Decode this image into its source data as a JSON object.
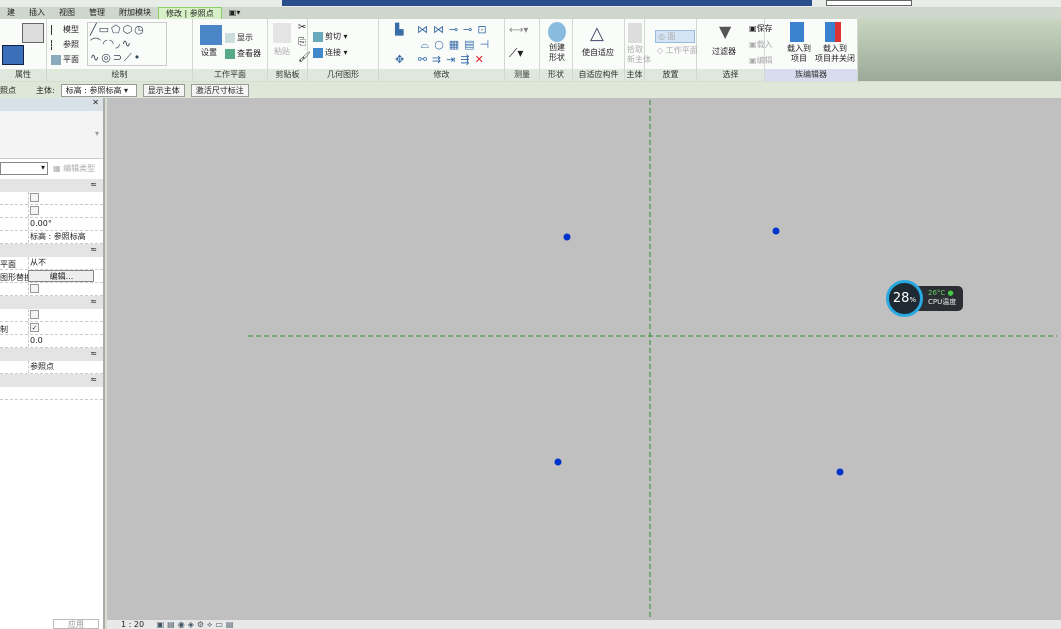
{
  "tabs": [
    "建",
    "插入",
    "视图",
    "管理",
    "附加模块",
    "修改 | 参照点",
    "▣▾"
  ],
  "active_tab": "修改 | 参照点",
  "ribbon": {
    "groups": [
      "属性",
      "绘制",
      "工作平面",
      "剪贴板",
      "几何图形",
      "修改",
      "测量",
      "形状",
      "自适应构件",
      "主体",
      "放置",
      "选择",
      "族编辑器"
    ],
    "draw": {
      "model": "模型",
      "ref": "参照",
      "plane": "平面"
    },
    "workplane": {
      "set": "设置",
      "show": "显示",
      "viewer": "查看器"
    },
    "clipboard": {
      "paste": "粘贴"
    },
    "geometry": {
      "cut": "剪切",
      "join": "连接"
    },
    "shape": {
      "create": "创建\n形状"
    },
    "adaptive": {
      "make": "使自适应"
    },
    "host": {
      "pick": "拾取\n新主体"
    },
    "place": {
      "face": "面",
      "workplane": "工作平面"
    },
    "select": {
      "filter": "过滤器",
      "save": "保存",
      "load": "载入",
      "edit": "编辑"
    },
    "family": {
      "load_project": "载入到\n项目",
      "load_close": "载入到\n项目并关闭"
    }
  },
  "options_bar": {
    "left": "照点",
    "host_label": "主体:",
    "host_value": "标高 : 参照标高",
    "show_host": "显示主体",
    "activate_dim": "激活尺寸标注"
  },
  "properties": {
    "edit_type": "编辑类型",
    "rows1": [
      {
        "k": "",
        "v": "",
        "cb": true
      },
      {
        "k": "",
        "v": "",
        "cb": true
      },
      {
        "k": "",
        "v": "0.00°"
      },
      {
        "k": "",
        "v": "标高 : 参照标高"
      }
    ],
    "rows2": [
      {
        "k": "平面",
        "v": "从不"
      },
      {
        "k": "图形替换",
        "v": "编辑..."
      },
      {
        "k": "",
        "v": "",
        "cb": true
      }
    ],
    "rows3": [
      {
        "k": "",
        "v": "",
        "cb": true
      },
      {
        "k": "制",
        "v": "✓",
        "cb": true
      },
      {
        "k": "",
        "v": "0.0"
      }
    ],
    "rows4": [
      {
        "k": "",
        "v": "参照点"
      }
    ],
    "apply": "应用"
  },
  "status": {
    "scale": "1 : 20"
  },
  "cpu": {
    "percent": "28",
    "unit": "%",
    "temp": "26°C",
    "label": "CPU温度"
  },
  "canvas": {
    "points": 4,
    "ref_line_color": "#2e8b2e",
    "point_color": "#0033cc"
  }
}
